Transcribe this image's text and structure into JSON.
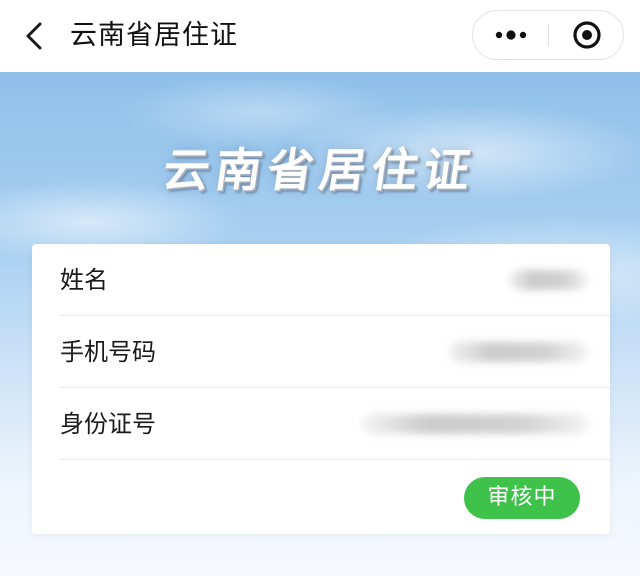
{
  "nav": {
    "title": "云南省居住证",
    "icons": {
      "back": "chevron-left-icon",
      "more": "more-dots-icon",
      "close": "target-close-icon"
    }
  },
  "banner": {
    "title": "云南省居住证"
  },
  "card": {
    "rows": [
      {
        "label": "姓名",
        "value": ""
      },
      {
        "label": "手机号码",
        "value": ""
      },
      {
        "label": "身份证号",
        "value": ""
      }
    ],
    "status": "审核中"
  },
  "colors": {
    "status_green": "#3ec24a",
    "sky_top": "#8fc0ea",
    "sky_bottom": "#f6f9fd"
  }
}
